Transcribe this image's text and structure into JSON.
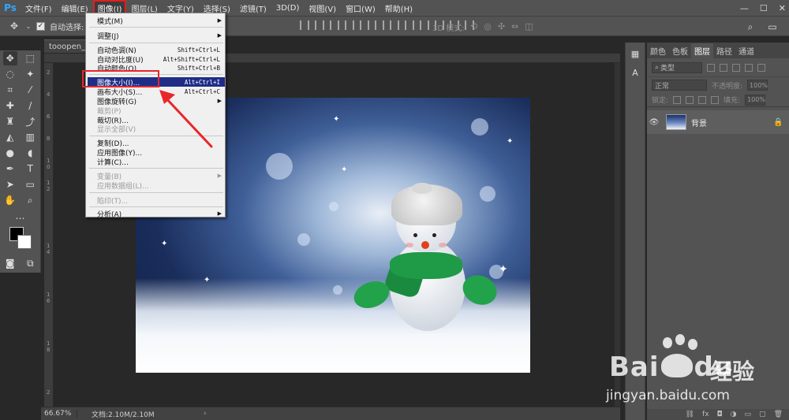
{
  "app": {
    "logo": "Ps",
    "menus": [
      "文件(F)",
      "编辑(E)",
      "图像(I)",
      "图层(L)",
      "文字(Y)",
      "选择(S)",
      "滤镜(T)",
      "3D(D)",
      "视图(V)",
      "窗口(W)",
      "帮助(H)"
    ],
    "active_menu_index": 2,
    "window_buttons": [
      "—",
      "☐",
      "✕"
    ]
  },
  "options": {
    "auto_select_label": "自动选择:",
    "mode_3d_label": "3D 模式:"
  },
  "document": {
    "tab_title": "tooopen_sy_",
    "zoom": "66.67%",
    "doc_size": "文档:2.10M/2.10M",
    "ruler_left_nums": [
      "2",
      "4",
      "6",
      "8",
      "1",
      "0",
      "1",
      "2",
      "1",
      "4",
      "1",
      "6",
      "1",
      "8",
      "2"
    ]
  },
  "menu": {
    "items": [
      {
        "label": "模式(M)",
        "shortcut": "",
        "submenu": true,
        "disabled": false
      },
      {
        "label": "调整(J)",
        "shortcut": "",
        "submenu": true,
        "disabled": false
      },
      {
        "label": "自动色调(N)",
        "shortcut": "Shift+Ctrl+L",
        "submenu": false,
        "disabled": false
      },
      {
        "label": "自动对比度(U)",
        "shortcut": "Alt+Shift+Ctrl+L",
        "submenu": false,
        "disabled": false
      },
      {
        "label": "自动颜色(O)",
        "shortcut": "Shift+Ctrl+B",
        "submenu": false,
        "disabled": false
      },
      {
        "label": "图像大小(I)...",
        "shortcut": "Alt+Ctrl+I",
        "submenu": false,
        "disabled": false,
        "highlighted": true
      },
      {
        "label": "画布大小(S)...",
        "shortcut": "Alt+Ctrl+C",
        "submenu": false,
        "disabled": false
      },
      {
        "label": "图像旋转(G)",
        "shortcut": "",
        "submenu": true,
        "disabled": false
      },
      {
        "label": "裁剪(P)",
        "shortcut": "",
        "submenu": false,
        "disabled": true
      },
      {
        "label": "裁切(R)...",
        "shortcut": "",
        "submenu": false,
        "disabled": false
      },
      {
        "label": "显示全部(V)",
        "shortcut": "",
        "submenu": false,
        "disabled": true
      },
      {
        "label": "复制(D)...",
        "shortcut": "",
        "submenu": false,
        "disabled": false
      },
      {
        "label": "应用图像(Y)...",
        "shortcut": "",
        "submenu": false,
        "disabled": false
      },
      {
        "label": "计算(C)...",
        "shortcut": "",
        "submenu": false,
        "disabled": false
      },
      {
        "label": "变量(B)",
        "shortcut": "",
        "submenu": true,
        "disabled": true
      },
      {
        "label": "应用数据组(L)...",
        "shortcut": "",
        "submenu": false,
        "disabled": true
      },
      {
        "label": "陷印(T)...",
        "shortcut": "",
        "submenu": false,
        "disabled": true
      },
      {
        "label": "分析(A)",
        "shortcut": "",
        "submenu": true,
        "disabled": false
      }
    ]
  },
  "layers_panel": {
    "tabs": [
      "颜色",
      "色板",
      "图层",
      "路径",
      "通道"
    ],
    "active_tab_index": 2,
    "filter_label": "类型",
    "blend_mode": "正常",
    "opacity_label": "不透明度:",
    "opacity_value": "100%",
    "lock_label": "锁定:",
    "fill_label": "填充:",
    "fill_value": "100%",
    "layers": [
      {
        "name": "背景",
        "visible": true,
        "locked": true
      }
    ],
    "bottom_icons": [
      "⛓",
      "fx",
      "◘",
      "◑",
      "▭",
      "▢",
      "🗑"
    ]
  },
  "watermark": {
    "logo_text": "Bai",
    "logo_text_2": "du",
    "product": "经验",
    "url": "jingyan.baidu.com"
  },
  "colors": {
    "menu_highlight": "#1f2d87",
    "annotation_red": "#e8262a",
    "ps_blue": "#31a8ff"
  }
}
